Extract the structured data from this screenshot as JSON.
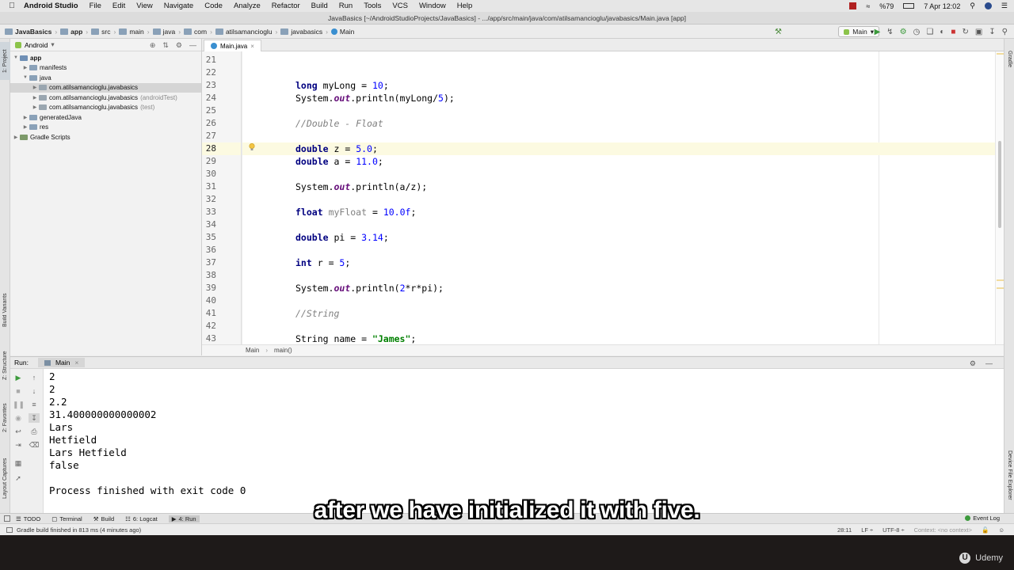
{
  "menubar": {
    "app": "Android Studio",
    "items": [
      "File",
      "Edit",
      "View",
      "Navigate",
      "Code",
      "Analyze",
      "Refactor",
      "Build",
      "Run",
      "Tools",
      "VCS",
      "Window",
      "Help"
    ],
    "battery": "%79",
    "clock": "7 Apr 12:02"
  },
  "window_title": "JavaBasics [~/AndroidStudioProjects/JavaBasics] - .../app/src/main/java/com/atilsamancioglu/javabasics/Main.java [app]",
  "navbar": {
    "crumbs": [
      "JavaBasics",
      "app",
      "src",
      "main",
      "java",
      "com",
      "atilsamancioglu",
      "javabasics",
      "Main"
    ],
    "run_config": "Main"
  },
  "left_stripe": [
    "1: Project",
    "Build Variants",
    "Z: Structure",
    "2: Favorites",
    "Layout Captures"
  ],
  "right_stripe": [
    "Gradle",
    "Device File Explorer"
  ],
  "project": {
    "view": "Android",
    "tree": [
      {
        "label": "app",
        "note": "",
        "level": 0,
        "arrow": "▼",
        "color": "#6f8fb5",
        "bold": true
      },
      {
        "label": "manifests",
        "note": "",
        "level": 1,
        "arrow": "▶",
        "color": "#8aa1b8"
      },
      {
        "label": "java",
        "note": "",
        "level": 1,
        "arrow": "▼",
        "color": "#8aa1b8"
      },
      {
        "label": "com.atilsamancioglu.javabasics",
        "note": "",
        "level": 2,
        "arrow": "▶",
        "color": "#9aa6b0",
        "selected": true
      },
      {
        "label": "com.atilsamancioglu.javabasics",
        "note": "(androidTest)",
        "level": 2,
        "arrow": "▶",
        "color": "#9aa6b0"
      },
      {
        "label": "com.atilsamancioglu.javabasics",
        "note": "(test)",
        "level": 2,
        "arrow": "▶",
        "color": "#9aa6b0"
      },
      {
        "label": "generatedJava",
        "note": "",
        "level": 1,
        "arrow": "▶",
        "color": "#8aa1b8"
      },
      {
        "label": "res",
        "note": "",
        "level": 1,
        "arrow": "▶",
        "color": "#8aa1b8"
      },
      {
        "label": "Gradle Scripts",
        "note": "",
        "level": 0,
        "arrow": "▶",
        "color": "#7d9a6a"
      }
    ]
  },
  "editor": {
    "tab": "Main.java",
    "current_line": 28,
    "lines": [
      {
        "n": 21,
        "t": []
      },
      {
        "n": 22,
        "t": []
      },
      {
        "n": 23,
        "t": [
          [
            "kw",
            "long"
          ],
          [
            "",
            "myLong = "
          ],
          [
            "num",
            "10"
          ],
          [
            "",
            ";"
          ]
        ]
      },
      {
        "n": 24,
        "t": [
          [
            "",
            "System."
          ],
          [
            "fld",
            "out"
          ],
          [
            "",
            ".println(myLong/"
          ],
          [
            "num",
            "5"
          ],
          [
            "",
            ");"
          ]
        ]
      },
      {
        "n": 25,
        "t": []
      },
      {
        "n": 26,
        "t": [
          [
            "cmt",
            "//Double - Float"
          ]
        ]
      },
      {
        "n": 27,
        "t": []
      },
      {
        "n": 28,
        "t": [
          [
            "kw",
            "double"
          ],
          [
            "",
            "z = "
          ],
          [
            "num",
            "5.0"
          ],
          [
            "",
            ";"
          ]
        ]
      },
      {
        "n": 29,
        "t": [
          [
            "kw",
            "double"
          ],
          [
            "",
            "a = "
          ],
          [
            "num",
            "11.0"
          ],
          [
            "",
            ";"
          ]
        ]
      },
      {
        "n": 30,
        "t": []
      },
      {
        "n": 31,
        "t": [
          [
            "",
            "System."
          ],
          [
            "fld",
            "out"
          ],
          [
            "",
            ".println(a/z);"
          ]
        ]
      },
      {
        "n": 32,
        "t": []
      },
      {
        "n": 33,
        "t": [
          [
            "kw",
            "float"
          ],
          [
            "unused",
            "myFloat"
          ],
          [
            "",
            " = "
          ],
          [
            "num",
            "10.0f"
          ],
          [
            "",
            ";"
          ]
        ]
      },
      {
        "n": 34,
        "t": []
      },
      {
        "n": 35,
        "t": [
          [
            "kw",
            "double"
          ],
          [
            "",
            "pi = "
          ],
          [
            "num",
            "3.14"
          ],
          [
            "",
            ";"
          ]
        ]
      },
      {
        "n": 36,
        "t": []
      },
      {
        "n": 37,
        "t": [
          [
            "kw",
            "int"
          ],
          [
            "",
            "r = "
          ],
          [
            "num",
            "5"
          ],
          [
            "",
            ";"
          ]
        ]
      },
      {
        "n": 38,
        "t": []
      },
      {
        "n": 39,
        "t": [
          [
            "",
            "System."
          ],
          [
            "fld",
            "out"
          ],
          [
            "",
            ".println("
          ],
          [
            "num",
            "2"
          ],
          [
            "",
            "*r*pi);"
          ]
        ]
      },
      {
        "n": 40,
        "t": []
      },
      {
        "n": 41,
        "t": [
          [
            "cmt",
            "//String"
          ]
        ]
      },
      {
        "n": 42,
        "t": []
      },
      {
        "n": 43,
        "t": [
          [
            "",
            "String name = "
          ],
          [
            "str",
            "\"James\""
          ],
          [
            "",
            ";"
          ]
        ]
      }
    ],
    "breadcrumb": [
      "Main",
      "main()"
    ]
  },
  "run": {
    "label": "Run:",
    "tab": "Main",
    "output": [
      "2",
      "2",
      "2.2",
      "31.400000000000002",
      "Lars",
      "Hetfield",
      "Lars Hetfield",
      "false",
      "",
      "Process finished with exit code 0"
    ]
  },
  "toolwindows": [
    {
      "label": "TODO",
      "active": false
    },
    {
      "label": "Terminal",
      "active": false
    },
    {
      "label": "Build",
      "active": false
    },
    {
      "label": "6: Logcat",
      "active": false
    },
    {
      "label": "4: Run",
      "active": true
    }
  ],
  "event_log": "Event Log",
  "status": {
    "message": "Gradle build finished in 813 ms (4 minutes ago)",
    "position": "28:11",
    "line_sep": "LF ÷",
    "encoding": "UTF-8 ÷",
    "context": "Context: <no context>"
  },
  "subtitle": "after we have initialized it with five.",
  "watermark": "Udemy"
}
